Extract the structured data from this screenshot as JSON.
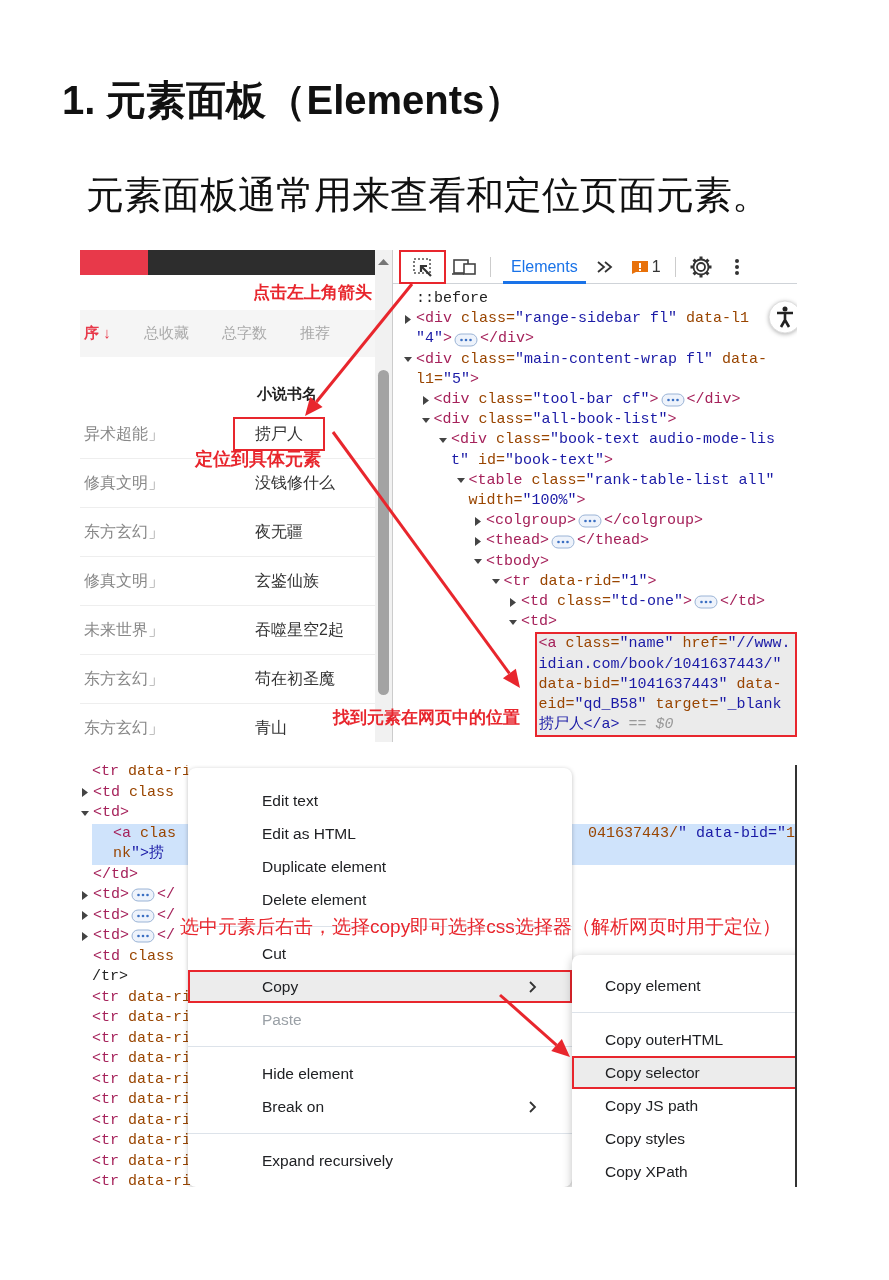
{
  "heading": "1. 元素面板（Elements）",
  "intro": "元素面板通常用来查看和定位页面元素。",
  "screenshot_1": {
    "webpage": {
      "annotation_top": "点击左上角箭头",
      "sort_tabs": [
        {
          "label": "序 ↓",
          "selected": true
        },
        {
          "label": "总收藏",
          "selected": false
        },
        {
          "label": "总字数",
          "selected": false
        },
        {
          "label": "推荐",
          "selected": false
        }
      ],
      "column_title": "小说书名",
      "rows": [
        {
          "category": "异术超能」",
          "title": "捞尸人",
          "boxed": true
        },
        {
          "category": "修真文明」",
          "title": "没钱修什么",
          "boxed": false
        },
        {
          "category": "东方玄幻」",
          "title": "夜无疆",
          "boxed": false
        },
        {
          "category": "修真文明」",
          "title": "玄鉴仙族",
          "boxed": false
        },
        {
          "category": "未来世界」",
          "title": "吞噬星空2起",
          "boxed": false
        },
        {
          "category": "东方玄幻」",
          "title": "苟在初圣魔",
          "boxed": false
        },
        {
          "category": "东方玄幻」",
          "title": "青山",
          "boxed": false
        }
      ],
      "annotation_locate": "定位到具体元素"
    },
    "annotation_find": "找到元素在网页中的位置",
    "devtools": {
      "tabs": [
        {
          "label": "Elements",
          "selected": true
        }
      ],
      "issues_count": "1",
      "tree": [
        {
          "kind": "plain",
          "selected": false,
          "lines": [
            "::before"
          ]
        },
        {
          "kind": "toggle",
          "expanded": false,
          "selected": false,
          "lines": [
            "<div class=\"range-sidebar fl\" data-l1",
            "\"4\">"
          ],
          "close": "</div>"
        },
        {
          "kind": "toggle",
          "expanded": true,
          "selected": false,
          "lines": [
            "<div class=\"main-content-wrap fl\" data-",
            "l1=\"5\">"
          ],
          "children": [
            {
              "kind": "toggle",
              "expanded": false,
              "selected": false,
              "lines": [
                "<div class=\"tool-bar cf\">"
              ],
              "close": "</div>"
            },
            {
              "kind": "toggle",
              "expanded": true,
              "selected": false,
              "lines": [
                "<div class=\"all-book-list\">"
              ],
              "children": [
                {
                  "kind": "toggle",
                  "expanded": true,
                  "selected": false,
                  "lines": [
                    "<div class=\"book-text audio-mode-lis",
                    "t\" id=\"book-text\">"
                  ],
                  "children": [
                    {
                      "kind": "toggle",
                      "expanded": true,
                      "selected": false,
                      "lines": [
                        "<table class=\"rank-table-list all\"",
                        "width=\"100%\">"
                      ],
                      "children": [
                        {
                          "kind": "toggle",
                          "expanded": false,
                          "selected": false,
                          "lines": [
                            "<colgroup>"
                          ],
                          "close": "</colgroup>"
                        },
                        {
                          "kind": "toggle",
                          "expanded": false,
                          "selected": false,
                          "lines": [
                            "<thead>"
                          ],
                          "close": "</thead>"
                        },
                        {
                          "kind": "toggle",
                          "expanded": true,
                          "selected": false,
                          "lines": [
                            "<tbody>"
                          ],
                          "children": [
                            {
                              "kind": "toggle",
                              "expanded": true,
                              "selected": false,
                              "lines": [
                                "<tr data-rid=\"1\">"
                              ],
                              "children": [
                                {
                                  "kind": "toggle",
                                  "expanded": false,
                                  "selected": false,
                                  "lines": [
                                    "<td class=\"td-one\">"
                                  ],
                                  "close": "</td>"
                                },
                                {
                                  "kind": "toggle",
                                  "expanded": true,
                                  "selected": false,
                                  "lines": [
                                    "<td>"
                                  ],
                                  "children": [
                                    {
                                      "kind": "plain",
                                      "selected": true,
                                      "lines": [
                                        "<a class=\"name\" href=\"//www.",
                                        "idian.com/book/1041637443/\"",
                                        "data-bid=\"1041637443\" data-",
                                        "eid=\"qd_B58\" target=\"_blank",
                                        "捞尸人</a>"
                                      ],
                                      "suffix": "== $0"
                                    }
                                  ]
                                }
                              ]
                            }
                          ]
                        }
                      ]
                    }
                  ]
                }
              ]
            }
          ]
        }
      ]
    }
  },
  "screenshot_2": {
    "tree": [
      {
        "kind": "plain",
        "selected": false,
        "lines": [
          "<tr data-ri"
        ],
        "children": [
          {
            "kind": "toggle",
            "expanded": false,
            "selected": false,
            "lines": [
              "<td class"
            ]
          },
          {
            "kind": "toggle",
            "expanded": true,
            "selected": false,
            "lines": [
              "<td>"
            ],
            "children": [
              {
                "kind": "plain",
                "selected": true,
                "lines": [
                  "<a clas",
                  "nk\">捞"
                ],
                "right_part": "041637443/\" data-bid=\"1"
              }
            ]
          },
          {
            "kind": "plain",
            "selected": false,
            "lines": [
              "</td>"
            ]
          },
          {
            "kind": "toggle",
            "expanded": false,
            "selected": false,
            "lines": [
              "<td>"
            ],
            "close": "</"
          },
          {
            "kind": "toggle",
            "expanded": false,
            "selected": false,
            "lines": [
              "<td>"
            ],
            "close": "</"
          },
          {
            "kind": "toggle",
            "expanded": false,
            "selected": false,
            "lines": [
              "<td>"
            ],
            "close": "</"
          },
          {
            "kind": "plain",
            "selected": false,
            "lines": [
              "<td class"
            ]
          }
        ]
      },
      {
        "kind": "plain",
        "selected": false,
        "lines": [
          "/tr>"
        ]
      },
      {
        "kind": "plain",
        "selected": false,
        "lines": [
          "<tr data-ri"
        ]
      },
      {
        "kind": "plain",
        "selected": false,
        "lines": [
          "<tr data-ri"
        ]
      },
      {
        "kind": "plain",
        "selected": false,
        "lines": [
          "<tr data-ri"
        ]
      },
      {
        "kind": "plain",
        "selected": false,
        "lines": [
          "<tr data-ri"
        ]
      },
      {
        "kind": "plain",
        "selected": false,
        "lines": [
          "<tr data-ri"
        ]
      },
      {
        "kind": "plain",
        "selected": false,
        "lines": [
          "<tr data-ri"
        ]
      },
      {
        "kind": "plain",
        "selected": false,
        "lines": [
          "<tr data-ri"
        ]
      },
      {
        "kind": "plain",
        "selected": false,
        "lines": [
          "<tr data-ri"
        ]
      },
      {
        "kind": "plain",
        "selected": false,
        "lines": [
          "<tr data-ri"
        ]
      },
      {
        "kind": "plain",
        "selected": false,
        "lines": [
          "<tr data-ri"
        ]
      }
    ],
    "context_menu": [
      {
        "kind": "item",
        "label": "Edit text",
        "selected": false,
        "disabled": false,
        "submenu": false
      },
      {
        "kind": "item",
        "label": "Edit as HTML",
        "selected": false,
        "disabled": false,
        "submenu": false
      },
      {
        "kind": "item",
        "label": "Duplicate element",
        "selected": false,
        "disabled": false,
        "submenu": false
      },
      {
        "kind": "item",
        "label": "Delete element",
        "selected": false,
        "disabled": false,
        "submenu": false
      },
      {
        "kind": "separator"
      },
      {
        "kind": "item",
        "label": "Cut",
        "selected": false,
        "disabled": false,
        "submenu": false
      },
      {
        "kind": "item",
        "label": "Copy",
        "selected": true,
        "disabled": false,
        "submenu": true
      },
      {
        "kind": "item",
        "label": "Paste",
        "selected": false,
        "disabled": true,
        "submenu": false
      },
      {
        "kind": "separator"
      },
      {
        "kind": "item",
        "label": "Hide element",
        "selected": false,
        "disabled": false,
        "submenu": false
      },
      {
        "kind": "item",
        "label": "Break on",
        "selected": false,
        "disabled": false,
        "submenu": true
      },
      {
        "kind": "separator"
      },
      {
        "kind": "item",
        "label": "Expand recursively",
        "selected": false,
        "disabled": false,
        "submenu": false
      }
    ],
    "submenu": [
      {
        "kind": "item",
        "label": "Copy element",
        "selected": false,
        "disabled": false,
        "submenu": false
      },
      {
        "kind": "separator"
      },
      {
        "kind": "item",
        "label": "Copy outerHTML",
        "selected": false,
        "disabled": false,
        "submenu": false
      },
      {
        "kind": "item",
        "label": "Copy selector",
        "selected": true,
        "disabled": false,
        "submenu": false
      },
      {
        "kind": "item",
        "label": "Copy JS path",
        "selected": false,
        "disabled": false,
        "submenu": false
      },
      {
        "kind": "item",
        "label": "Copy styles",
        "selected": false,
        "disabled": false,
        "submenu": false
      },
      {
        "kind": "item",
        "label": "Copy XPath",
        "selected": false,
        "disabled": false,
        "submenu": false
      }
    ],
    "annotation": "选中元素后右击，选择copy即可选择css选择器（解析网页时用于定位）"
  }
}
